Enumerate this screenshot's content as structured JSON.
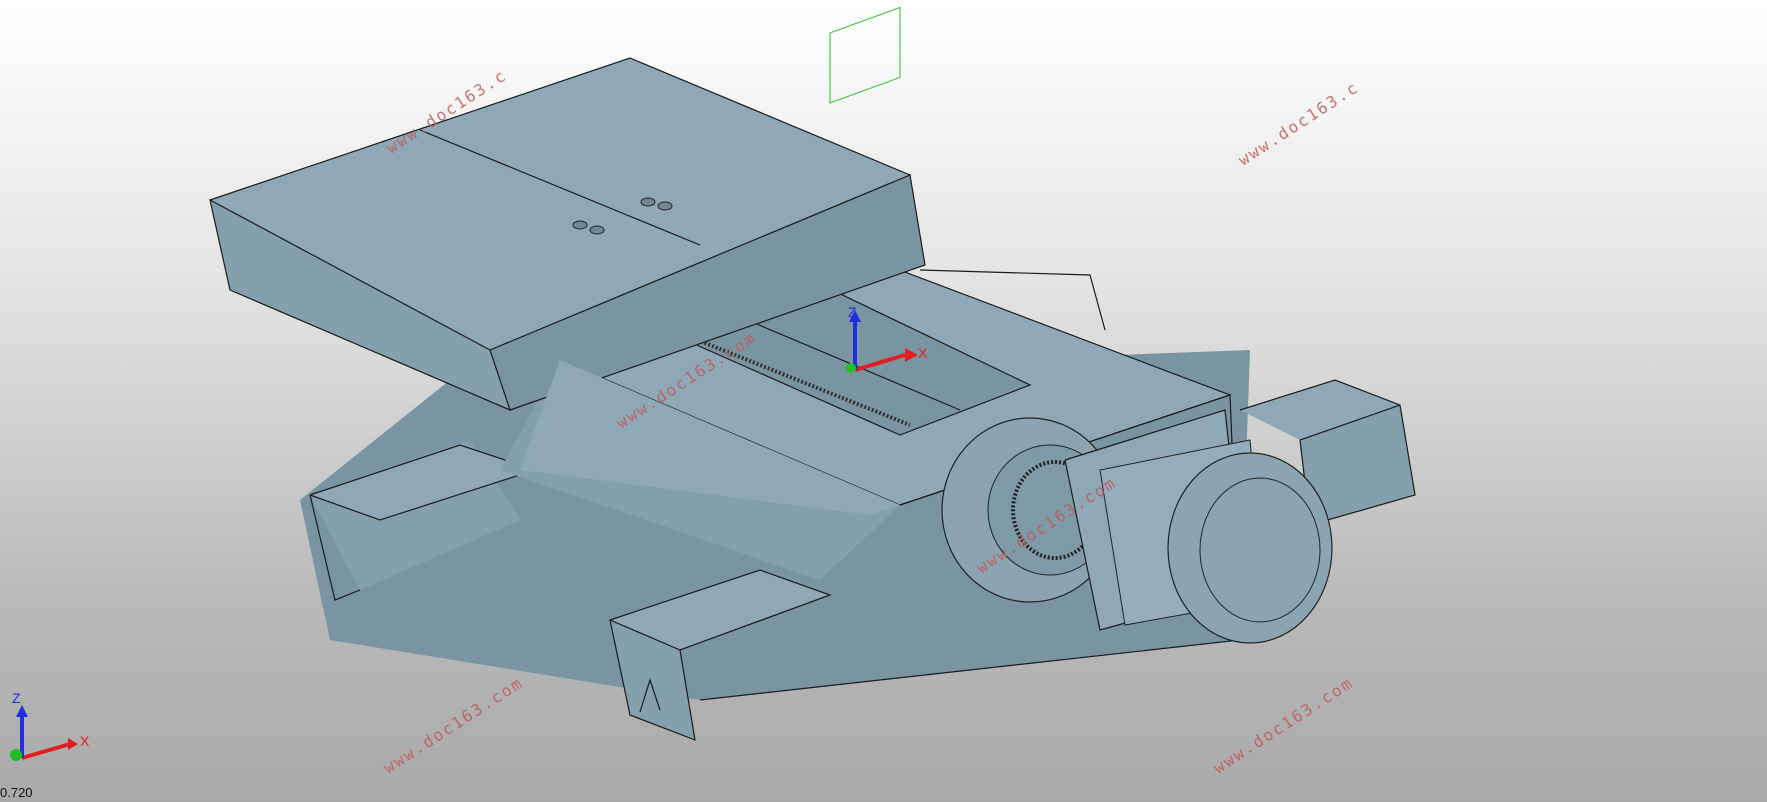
{
  "viewport": {
    "colors": {
      "body": "#8ea9b5",
      "x_axis": "#e02020",
      "y_axis": "#20c020",
      "z_axis": "#2030e0",
      "watermark": "#c05a5a"
    }
  },
  "triad_view": {
    "x_label": "X",
    "z_label": "Z"
  },
  "triad_corner": {
    "x_label": "X",
    "z_label": "Z"
  },
  "watermarks": [
    {
      "text": "www.doc163.c"
    },
    {
      "text": "www.doc163.c"
    },
    {
      "text": "www.doc163.com"
    },
    {
      "text": "www.doc163.com"
    },
    {
      "text": "www.doc163.com"
    },
    {
      "text": "www.doc163.com"
    }
  ],
  "status_bar": {
    "text": "0.720"
  }
}
